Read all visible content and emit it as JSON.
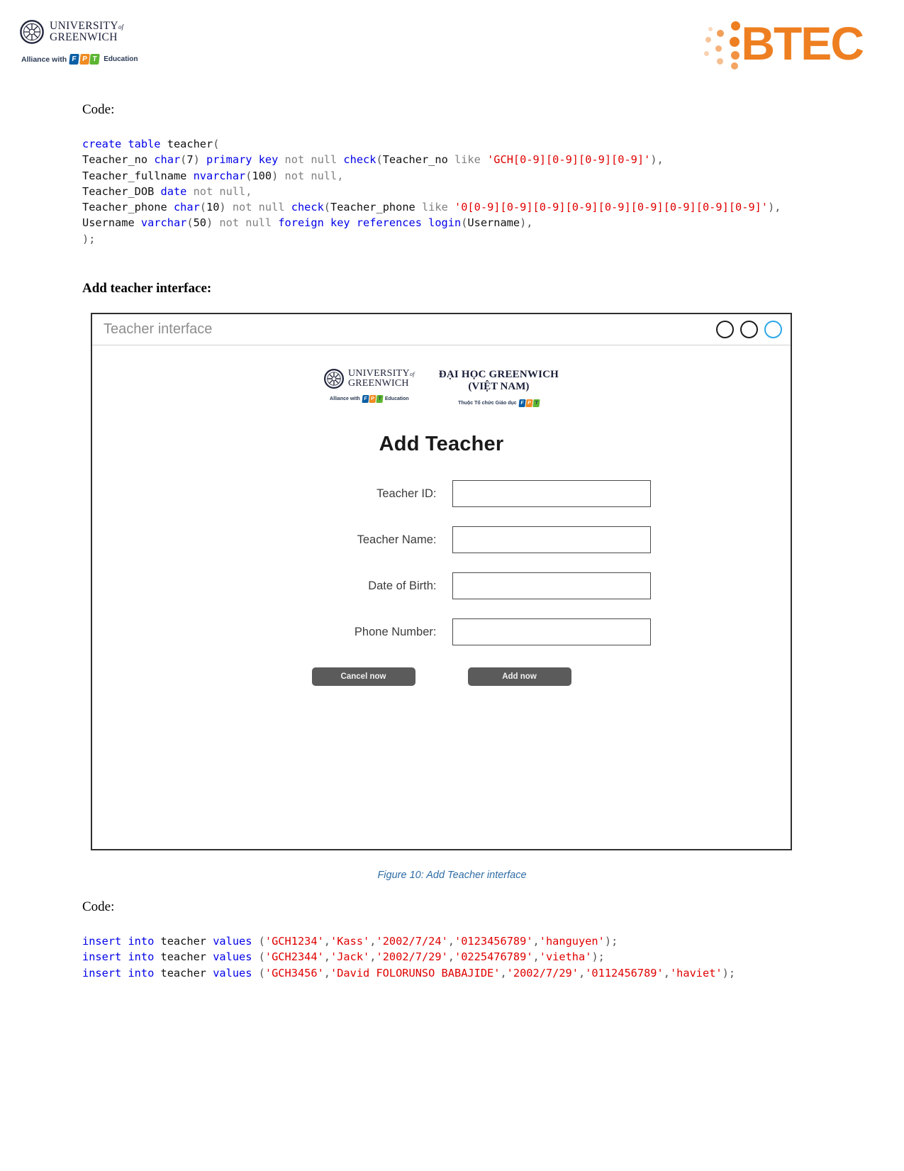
{
  "header": {
    "university": {
      "line1": "UNIVERSITY",
      "of": "of",
      "line2": "GREENWICH",
      "alliance_prefix": "Alliance with",
      "fpt": [
        "F",
        "P",
        "T"
      ],
      "alliance_suffix": "Education"
    },
    "btec": {
      "wordmark": "BTEC",
      "color": "#ee7f21"
    }
  },
  "sections": {
    "code_label_1": "Code:",
    "add_teacher_heading": "Add teacher interface:",
    "code_label_2": "Code:",
    "figure_caption": "Figure 10: Add Teacher interface"
  },
  "create_table_code": {
    "lines": [
      [
        {
          "t": "create table ",
          "c": "kw"
        },
        {
          "t": "teacher",
          "c": "id"
        },
        {
          "t": "(",
          "c": "pun"
        }
      ],
      [
        {
          "t": "Teacher_no ",
          "c": "id"
        },
        {
          "t": "char",
          "c": "kw"
        },
        {
          "t": "(",
          "c": "pun"
        },
        {
          "t": "7",
          "c": "id"
        },
        {
          "t": ") ",
          "c": "pun"
        },
        {
          "t": "primary key ",
          "c": "kw"
        },
        {
          "t": "not null ",
          "c": "kw2"
        },
        {
          "t": "check",
          "c": "kw"
        },
        {
          "t": "(",
          "c": "pun"
        },
        {
          "t": "Teacher_no ",
          "c": "id"
        },
        {
          "t": "like ",
          "c": "kw2"
        },
        {
          "t": "'GCH[0-9][0-9][0-9][0-9]'",
          "c": "str"
        },
        {
          "t": "),",
          "c": "pun"
        }
      ],
      [
        {
          "t": "Teacher_fullname ",
          "c": "id"
        },
        {
          "t": "nvarchar",
          "c": "kw"
        },
        {
          "t": "(",
          "c": "pun"
        },
        {
          "t": "100",
          "c": "id"
        },
        {
          "t": ") ",
          "c": "pun"
        },
        {
          "t": "not null,",
          "c": "kw2"
        }
      ],
      [
        {
          "t": "Teacher_DOB ",
          "c": "id"
        },
        {
          "t": "date ",
          "c": "kw"
        },
        {
          "t": "not null,",
          "c": "kw2"
        }
      ],
      [
        {
          "t": "Teacher_phone ",
          "c": "id"
        },
        {
          "t": "char",
          "c": "kw"
        },
        {
          "t": "(",
          "c": "pun"
        },
        {
          "t": "10",
          "c": "id"
        },
        {
          "t": ") ",
          "c": "pun"
        },
        {
          "t": "not null ",
          "c": "kw2"
        },
        {
          "t": "check",
          "c": "kw"
        },
        {
          "t": "(",
          "c": "pun"
        },
        {
          "t": "Teacher_phone ",
          "c": "id"
        },
        {
          "t": "like ",
          "c": "kw2"
        },
        {
          "t": "'0[0-9][0-9][0-9][0-9][0-9][0-9][0-9][0-9][0-9]'",
          "c": "str"
        },
        {
          "t": "),",
          "c": "pun"
        }
      ],
      [
        {
          "t": "Username ",
          "c": "id"
        },
        {
          "t": "varchar",
          "c": "kw"
        },
        {
          "t": "(",
          "c": "pun"
        },
        {
          "t": "50",
          "c": "id"
        },
        {
          "t": ") ",
          "c": "pun"
        },
        {
          "t": "not null ",
          "c": "kw2"
        },
        {
          "t": "foreign key references login",
          "c": "kw"
        },
        {
          "t": "(",
          "c": "pun"
        },
        {
          "t": "Username",
          "c": "id"
        },
        {
          "t": "),",
          "c": "pun"
        }
      ],
      [
        {
          "t": ");",
          "c": "pun"
        }
      ]
    ]
  },
  "insert_code": {
    "lines": [
      [
        {
          "t": "insert into ",
          "c": "kw"
        },
        {
          "t": "teacher ",
          "c": "id"
        },
        {
          "t": "values ",
          "c": "kw"
        },
        {
          "t": "(",
          "c": "pun"
        },
        {
          "t": "'GCH1234'",
          "c": "str"
        },
        {
          "t": ",",
          "c": "pun"
        },
        {
          "t": "'Kass'",
          "c": "str"
        },
        {
          "t": ",",
          "c": "pun"
        },
        {
          "t": "'2002/7/24'",
          "c": "str"
        },
        {
          "t": ",",
          "c": "pun"
        },
        {
          "t": "'0123456789'",
          "c": "str"
        },
        {
          "t": ",",
          "c": "pun"
        },
        {
          "t": "'hanguyen'",
          "c": "str"
        },
        {
          "t": ");",
          "c": "pun"
        }
      ],
      [
        {
          "t": "insert into ",
          "c": "kw"
        },
        {
          "t": "teacher ",
          "c": "id"
        },
        {
          "t": "values ",
          "c": "kw"
        },
        {
          "t": "(",
          "c": "pun"
        },
        {
          "t": "'GCH2344'",
          "c": "str"
        },
        {
          "t": ",",
          "c": "pun"
        },
        {
          "t": "'Jack'",
          "c": "str"
        },
        {
          "t": ",",
          "c": "pun"
        },
        {
          "t": "'2002/7/29'",
          "c": "str"
        },
        {
          "t": ",",
          "c": "pun"
        },
        {
          "t": "'0225476789'",
          "c": "str"
        },
        {
          "t": ",",
          "c": "pun"
        },
        {
          "t": "'vietha'",
          "c": "str"
        },
        {
          "t": ");",
          "c": "pun"
        }
      ],
      [
        {
          "t": "insert into ",
          "c": "kw"
        },
        {
          "t": "teacher ",
          "c": "id"
        },
        {
          "t": "values ",
          "c": "kw"
        },
        {
          "t": "(",
          "c": "pun"
        },
        {
          "t": "'GCH3456'",
          "c": "str"
        },
        {
          "t": ",",
          "c": "pun"
        },
        {
          "t": "'David FOLORUNSO BABAJIDE'",
          "c": "str"
        },
        {
          "t": ",",
          "c": "pun"
        },
        {
          "t": "'2002/7/29'",
          "c": "str"
        },
        {
          "t": ",",
          "c": "pun"
        },
        {
          "t": "'0112456789'",
          "c": "str"
        },
        {
          "t": ",",
          "c": "pun"
        },
        {
          "t": "'haviet'",
          "c": "str"
        },
        {
          "t": ");",
          "c": "pun"
        }
      ]
    ]
  },
  "app": {
    "title": "Teacher interface",
    "window_buttons": [
      {
        "name": "minimize",
        "accent": false
      },
      {
        "name": "maximize",
        "accent": false
      },
      {
        "name": "close",
        "accent": true
      }
    ],
    "logos": {
      "greenwich": {
        "line1": "UNIVERSITY",
        "of": "of",
        "line2": "GREENWICH",
        "sub_prefix": "Alliance with",
        "sub_suffix": "Education"
      },
      "vietnam": {
        "line1": "ĐẠI HỌC GREENWICH",
        "line2": "(VIỆT NAM)",
        "sub_prefix": "Thuộc Tổ chức Giáo dục"
      }
    },
    "form_title": "Add Teacher",
    "fields": [
      {
        "label": "Teacher ID:",
        "value": "",
        "placeholder": ""
      },
      {
        "label": "Teacher Name:",
        "value": "",
        "placeholder": ""
      },
      {
        "label": "Date of Birth:",
        "value": "",
        "placeholder": ""
      },
      {
        "label": "Phone Number:",
        "value": "",
        "placeholder": ""
      }
    ],
    "buttons": {
      "cancel": "Cancel now",
      "add": "Add now"
    }
  }
}
